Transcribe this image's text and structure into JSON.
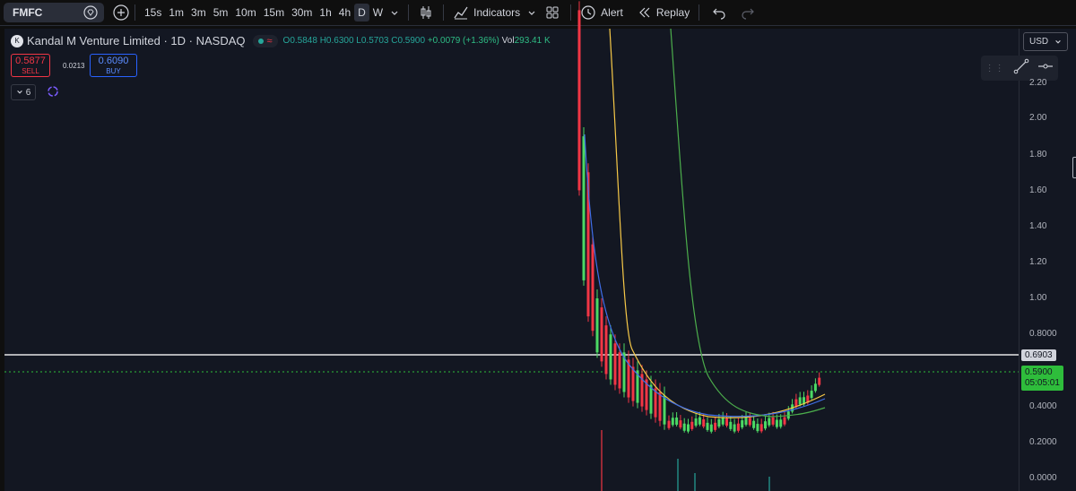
{
  "toolbar": {
    "symbol": "FMFC",
    "timeframes": [
      "15s",
      "1m",
      "3m",
      "5m",
      "10m",
      "15m",
      "30m",
      "1h",
      "4h",
      "D",
      "W"
    ],
    "active_timeframe": "D",
    "indicators_label": "Indicators",
    "alert_label": "Alert",
    "replay_label": "Replay"
  },
  "legend": {
    "title": "Kandal M Venture Limited · 1D · NASDAQ",
    "open": "O0.5848",
    "high": "H0.6300",
    "low": "L0.5703",
    "close": "C0.5900",
    "change": "+0.0079 (+1.36%)",
    "volume_label": "Vol",
    "volume_value": "293.41 K"
  },
  "trade": {
    "sell_price": "0.5877",
    "sell_label": "SELL",
    "spread": "0.0213",
    "buy_price": "0.6090",
    "buy_label": "BUY"
  },
  "collapse_count": "6",
  "currency": "USD",
  "price_axis": [
    "2.20",
    "2.00",
    "1.80",
    "1.60",
    "1.40",
    "1.20",
    "1.00",
    "0.8000",
    "0.6903",
    "0.5900",
    "0.4000",
    "0.2000",
    "0.0000"
  ],
  "horizontal_line_label": "0.6903",
  "last_price": "0.5900",
  "countdown": "05:05:01",
  "colors": {
    "up": "#26a69a",
    "down": "#f23645",
    "candle_up": "#4cd964",
    "ma_yellow": "#f7c948",
    "ma_blue": "#3f6ee8",
    "ma_green": "#4cae4c"
  }
}
